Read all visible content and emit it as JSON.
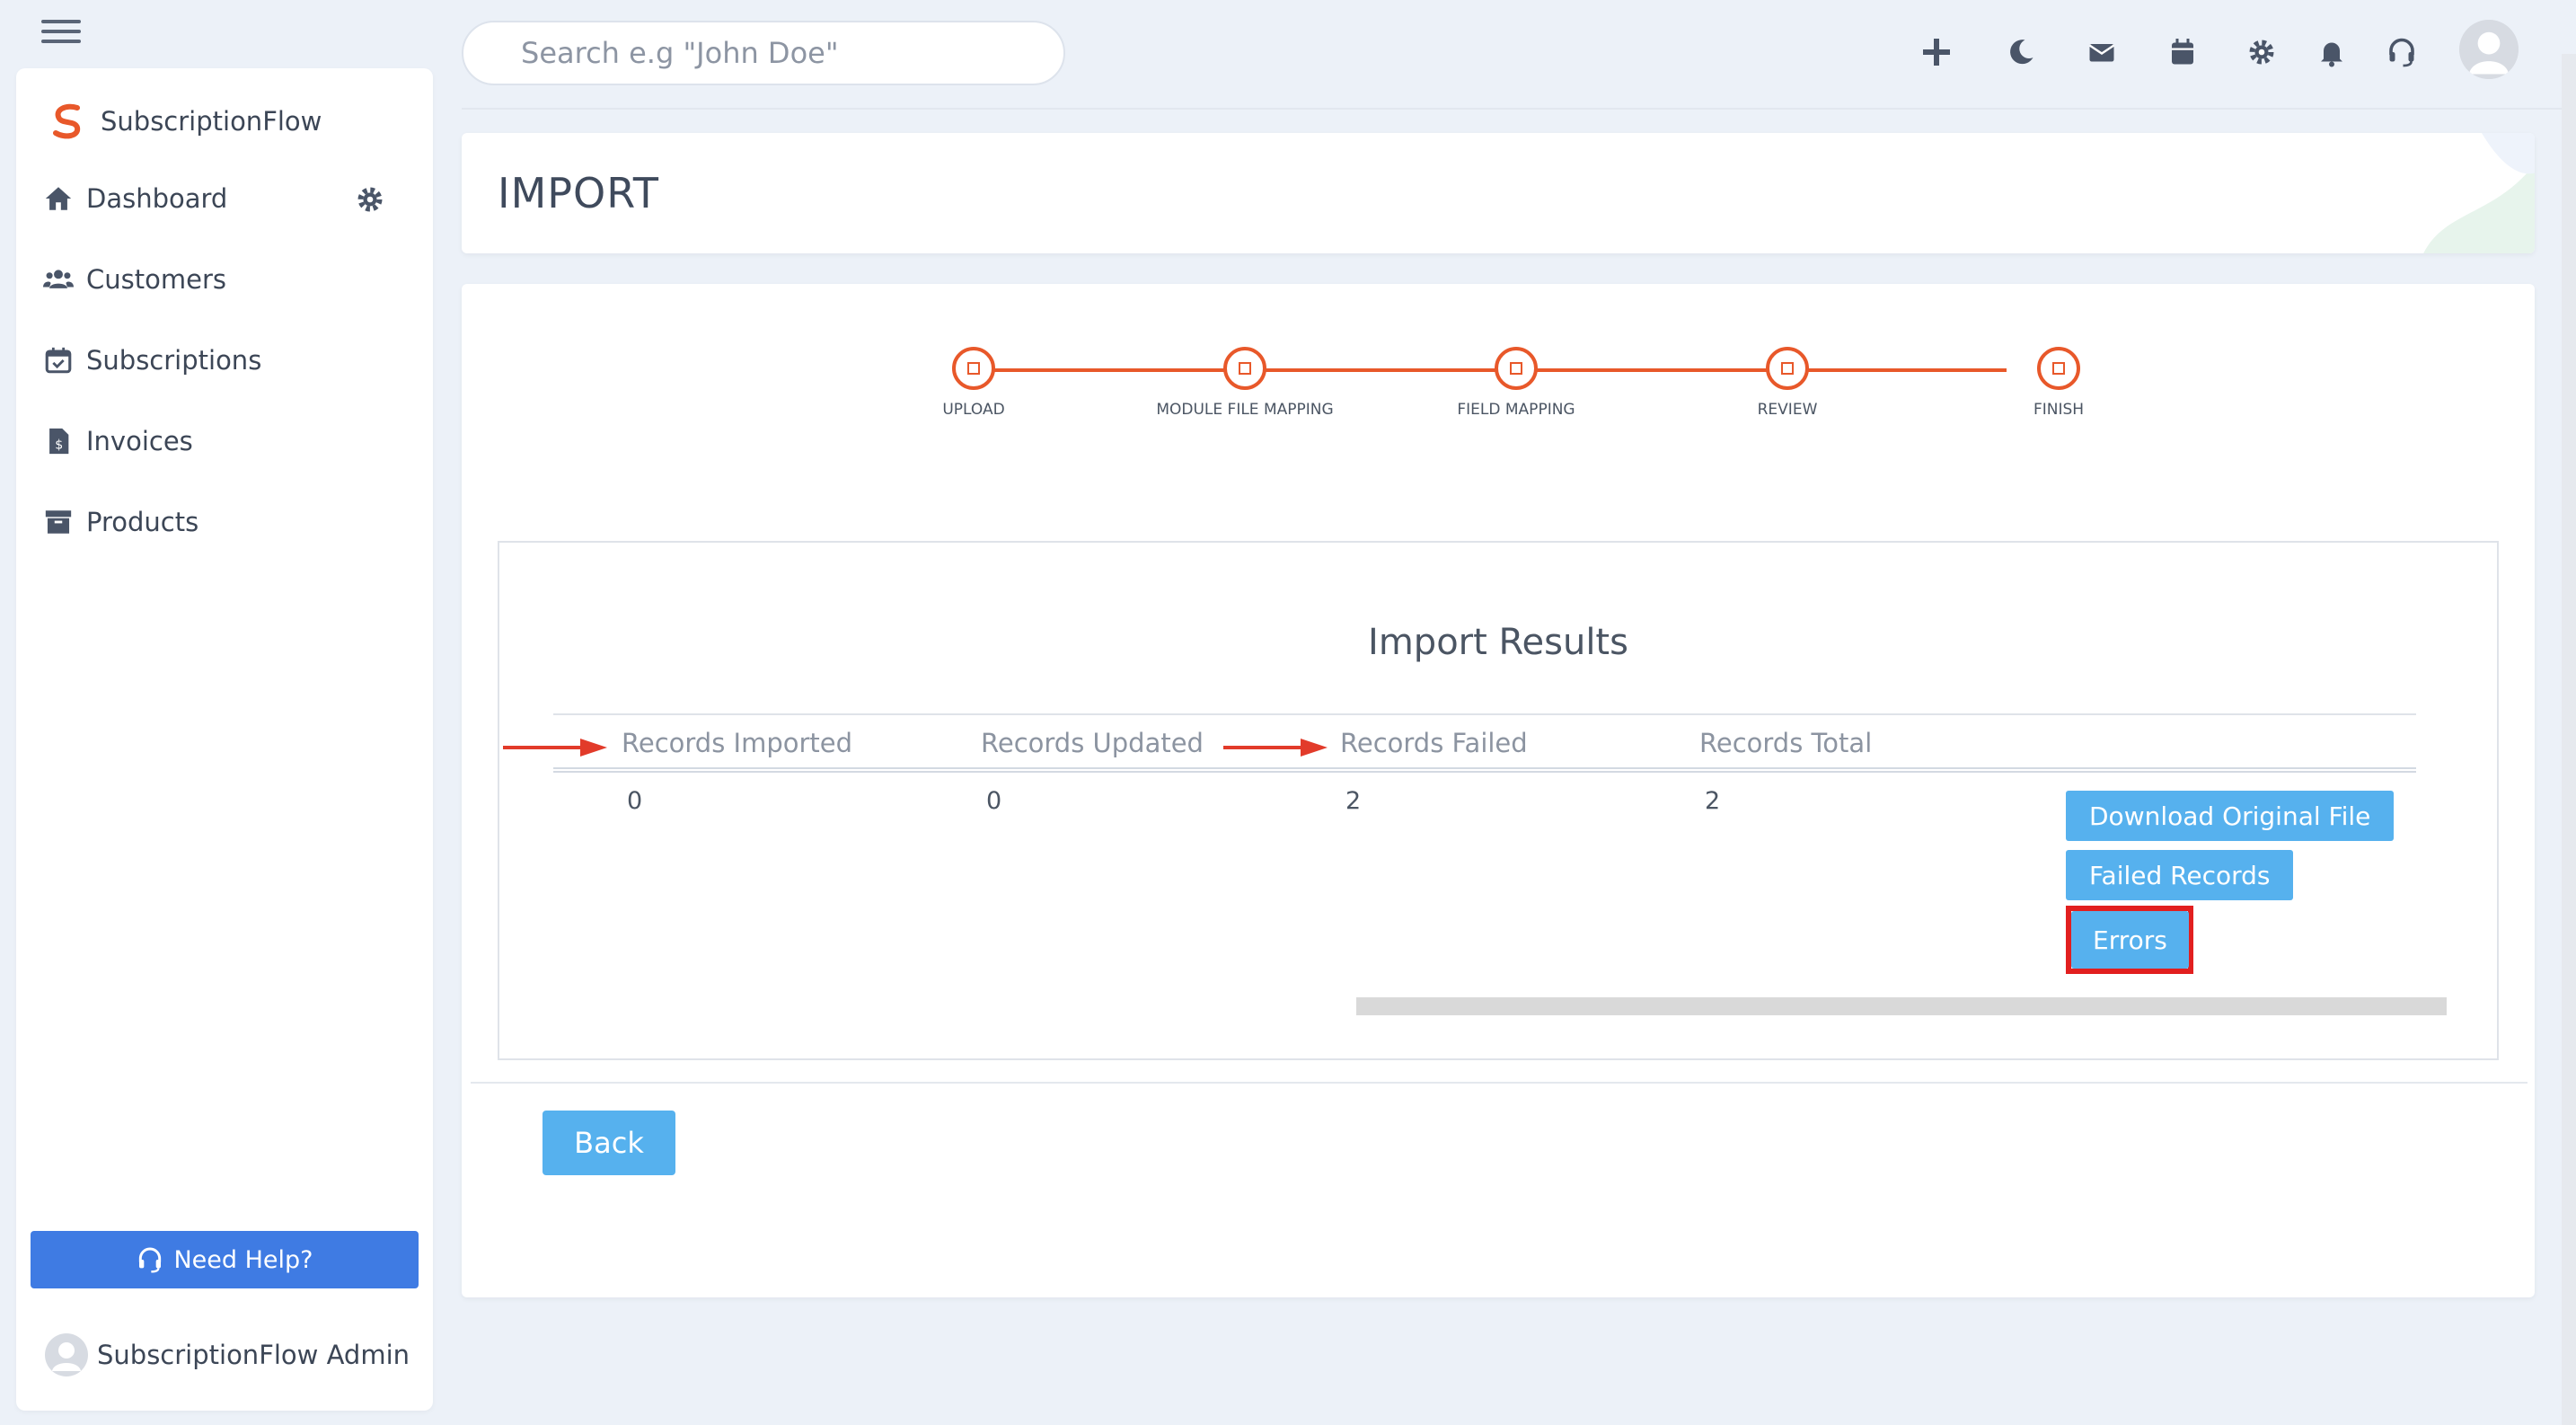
{
  "brand": {
    "name": "SubscriptionFlow",
    "colors": {
      "primary": "#e8582a",
      "accent_blue": "#56b1ee",
      "help_blue": "#3f7be3",
      "highlight_red": "#e21f1f"
    }
  },
  "sidebar": {
    "items": [
      {
        "label": "Dashboard",
        "icon": "home-icon"
      },
      {
        "label": "Customers",
        "icon": "users-icon"
      },
      {
        "label": "Subscriptions",
        "icon": "calendar-check-icon"
      },
      {
        "label": "Invoices",
        "icon": "invoice-icon"
      },
      {
        "label": "Products",
        "icon": "archive-icon"
      }
    ],
    "help_label": "Need Help?",
    "user_name": "SubscriptionFlow Admin"
  },
  "topbar": {
    "search_placeholder": "Search e.g \"John Doe\"",
    "icons": [
      "plus-icon",
      "moon-icon",
      "mail-icon",
      "calendar-icon",
      "gear-icon",
      "bell-icon",
      "headset-icon",
      "avatar"
    ]
  },
  "page": {
    "title": "IMPORT"
  },
  "stepper": {
    "steps": [
      "UPLOAD",
      "MODULE FILE MAPPING",
      "FIELD MAPPING",
      "REVIEW",
      "FINISH"
    ]
  },
  "results": {
    "title": "Import Results",
    "columns": [
      "Records Imported",
      "Records Updated",
      "Records Failed",
      "Records Total"
    ],
    "values": [
      "0",
      "0",
      "2",
      "2"
    ],
    "actions": {
      "download": "Download Original File",
      "failed": "Failed Records",
      "errors": "Errors"
    }
  },
  "footer": {
    "back_label": "Back"
  }
}
